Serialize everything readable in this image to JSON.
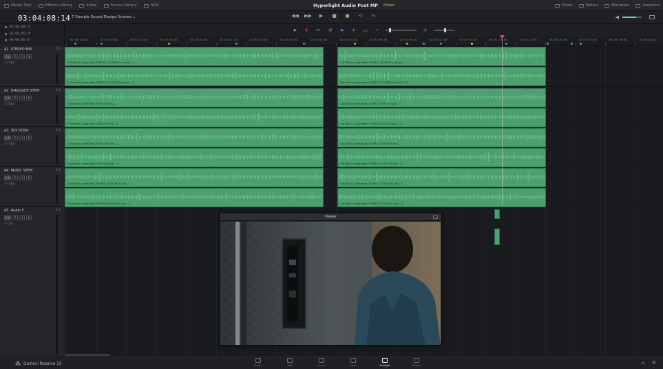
{
  "topbar": {
    "left_items": [
      "Media Pool",
      "Effects Library",
      "Index",
      "Sound Library",
      "ADR"
    ],
    "project_title": "Hyperlight Audio Post MP",
    "status": "Edited",
    "right_items": [
      "Mixer",
      "Meters",
      "Metadata",
      "Inspector"
    ]
  },
  "transport": {
    "timecode": "03:04:08:14",
    "timeline_name": "7 Sample Sound Design Scenes"
  },
  "clip_timecodes": [
    "01:00:40:13",
    "01:00:45:20",
    "00:00:05:07"
  ],
  "ruler_labels": [
    "00:00:00:00",
    "03:03:45:00",
    "03:03:42:00",
    "03:03:45:00",
    "03:03:48:00",
    "03:03:51:00",
    "03:03:54:00",
    "03:03:57:00",
    "03:04:00:00",
    "03:04:03:00",
    "03:04:06:00",
    "03:04:09:00",
    "03:04:12:00",
    "03:04:15:00",
    "03:04:18:00",
    "03:04:21:00",
    "03:04:24:00",
    "03:04:27:00",
    "03:04:30:00",
    "03:04:33:00"
  ],
  "tracks": [
    {
      "id": "A1",
      "name": "STEREO MIX",
      "channels": "2.0",
      "volume": "0.0",
      "buttons": [
        "R",
        "S",
        "M"
      ],
      "clips_label": "2 Clips"
    },
    {
      "id": "A2",
      "name": "DIALOGUE STEM",
      "channels": "2.0",
      "volume": "0.0",
      "buttons": [
        "R",
        "S",
        "M"
      ],
      "clips_label": "2 Clips"
    },
    {
      "id": "A3",
      "name": "SFX STEM",
      "channels": "2.0",
      "volume": "0.0",
      "buttons": [
        "R",
        "S",
        "M"
      ],
      "clips_label": "2 Clips"
    },
    {
      "id": "A4",
      "name": "MUSIC STEM",
      "channels": "2.0",
      "volume": "0.0",
      "buttons": [
        "R",
        "S",
        "M"
      ],
      "clips_label": "2 Clips"
    },
    {
      "id": "A5",
      "name": "Audio 5",
      "channels": "2.0",
      "volume": "0.0",
      "buttons": [
        "R",
        "S",
        "M"
      ],
      "clips_label": "1 Clip"
    }
  ],
  "clips": [
    {
      "lane": 0,
      "part": "left",
      "name": "Cult Nation_Hyperlight_STEREO_2019BD01_ref.wav - L"
    },
    {
      "lane": 0,
      "part": "right",
      "name": "Cult Nation_Hyperlight_STEREO_2019BD01_ref.wav - L"
    },
    {
      "lane": 1,
      "part": "left",
      "name": "Cult Nation_Hyperlight_STEREO_2019BD01_ref.wav - R"
    },
    {
      "lane": 1,
      "part": "right",
      "name": "Cult Nation_Hyperlight_STEREO_2019BD01_ref.wav - R"
    },
    {
      "lane": 2,
      "part": "left",
      "name": "Cult Nation_Hyperlight_STEM_VO.wav - L"
    },
    {
      "lane": 2,
      "part": "right",
      "name": "Cult Nation_Hyperlight_STEREO_STEM_VO.wav - L"
    },
    {
      "lane": 3,
      "part": "left",
      "name": "Cult Nation_Hyperlight_STEM_VO.wav - R"
    },
    {
      "lane": 3,
      "part": "right",
      "name": "Cult Nation_Hyperlight_STEREO_STEM_VO.wav - R"
    },
    {
      "lane": 4,
      "part": "left",
      "name": "Cult Nation_Hyperlight_STEM_SFX.wav - L"
    },
    {
      "lane": 4,
      "part": "right",
      "name": "Cult Nation_Hyperlight_STEREO_STEM_SFX.wav - L"
    },
    {
      "lane": 5,
      "part": "left",
      "name": "Cult Nation_Hyperlight_STEM_SFX.wav - R"
    },
    {
      "lane": 5,
      "part": "right",
      "name": "Cult Nation_Hyperlight_STEREO_STEM_SFX.wav - R"
    },
    {
      "lane": 6,
      "part": "left",
      "name": "Cult Nation_Hyperlight_STEREO_STEM_MUS.wav - L"
    },
    {
      "lane": 6,
      "part": "right",
      "name": "Cult Nation_Hyperlight_STEREO_STEM_MUS.wav - L"
    },
    {
      "lane": 7,
      "part": "left",
      "name": "Cult Nation_Hyperlight_STEREO_STEM_MUS.wav - R"
    },
    {
      "lane": 7,
      "part": "right",
      "name": "Cult Nation_Hyperlight_STEREO_STEM_MUS.wav - R"
    }
  ],
  "viewer": {
    "title": "Viewer"
  },
  "bottombar": {
    "brand": "DaVinci Resolve 15",
    "pages": [
      "Media",
      "Edit",
      "Fusion",
      "Color",
      "Fairlight",
      "Deliver"
    ],
    "active_page": "Fairlight"
  },
  "colors": {
    "clip_green": "#4aa06e",
    "playhead_red": "#e04848",
    "accent_orange": "#d9a441",
    "marker_blue": "#4a8fe0"
  }
}
